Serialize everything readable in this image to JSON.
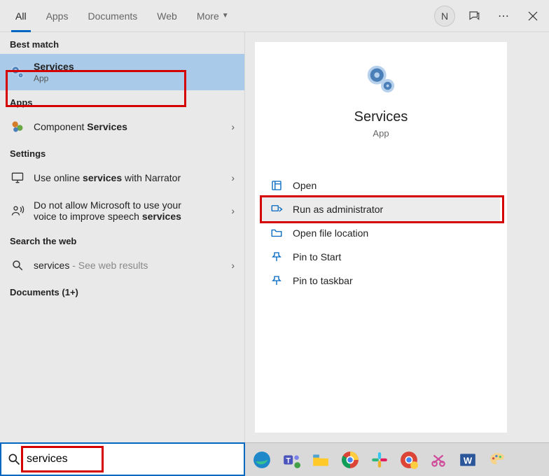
{
  "tabs": [
    "All",
    "Apps",
    "Documents",
    "Web",
    "More"
  ],
  "active_tab_index": 0,
  "user_initial": "N",
  "left": {
    "best_match_label": "Best match",
    "best_match": {
      "title": "Services",
      "sub": "App"
    },
    "apps_label": "Apps",
    "apps": [
      {
        "prefix": "Component ",
        "bold": "Services"
      }
    ],
    "settings_label": "Settings",
    "settings": [
      {
        "pre": "Use online ",
        "bold": "services",
        "post": " with Narrator"
      },
      {
        "pre": "Do not allow Microsoft to use your voice to improve speech ",
        "bold": "services",
        "post": ""
      }
    ],
    "web_label": "Search the web",
    "web": {
      "term": "services",
      "hint": " - See web results"
    },
    "documents_label": "Documents (1+)"
  },
  "detail": {
    "title": "Services",
    "sub": "App",
    "actions": [
      "Open",
      "Run as administrator",
      "Open file location",
      "Pin to Start",
      "Pin to taskbar"
    ]
  },
  "search_value": "services"
}
